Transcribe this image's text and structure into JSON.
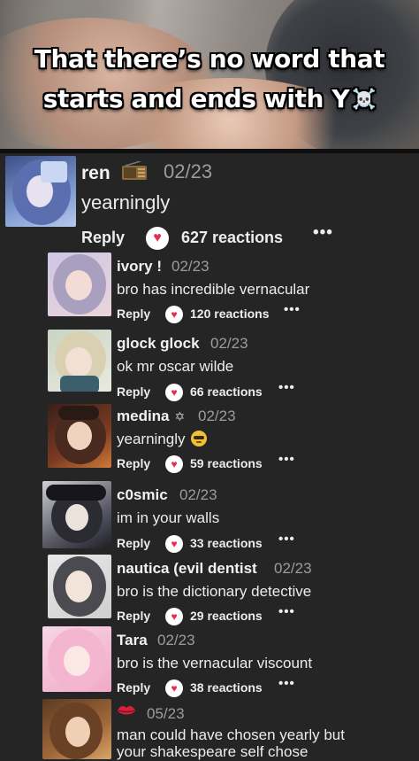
{
  "video": {
    "caption_line1": "That there’s no word that",
    "caption_line2": "starts and ends with Y",
    "caption_emoji": "☠️"
  },
  "main_comment": {
    "username": "ren",
    "badge_icon": "radio-icon",
    "date": "02/23",
    "text": "yearningly",
    "reply_label": "Reply",
    "reactions": "627 reactions"
  },
  "replies": [
    {
      "username": "ivory !",
      "date": "02/23",
      "text": "bro has incredible vernacular",
      "reply_label": "Reply",
      "reactions": "120 reactions"
    },
    {
      "username": "glock glock",
      "date": "02/23",
      "text": "ok mr oscar wilde",
      "reply_label": "Reply",
      "reactions": "66 reactions"
    },
    {
      "username": "medina",
      "badge": "✡",
      "date": "02/23",
      "text": "yearningly",
      "text_emoji": "nerd-face-icon",
      "reply_label": "Reply",
      "reactions": "59 reactions"
    },
    {
      "username": "c0smic",
      "date": "02/23",
      "text": "im in your walls",
      "reply_label": "Reply",
      "reactions": "33 reactions"
    },
    {
      "username": "nautica (evil dentist",
      "date": "02/23",
      "text": "bro is the dictionary detective",
      "reply_label": "Reply",
      "reactions": "29 reactions"
    },
    {
      "username": "Tara",
      "date": "02/23",
      "text": "bro is the vernacular viscount",
      "reply_label": "Reply",
      "reactions": "38 reactions"
    },
    {
      "username": "",
      "name_icon": "lips-icon",
      "date": "05/23",
      "text_line1": "man could have chosen yearly but",
      "text_line2": "your shakespeare self chose"
    }
  ],
  "ui": {
    "more_label": "•••",
    "heart_glyph": "♥"
  },
  "colors": {
    "background": "#252525",
    "heart_red": "#e0304e",
    "date_gray": "#9c9c9c"
  }
}
